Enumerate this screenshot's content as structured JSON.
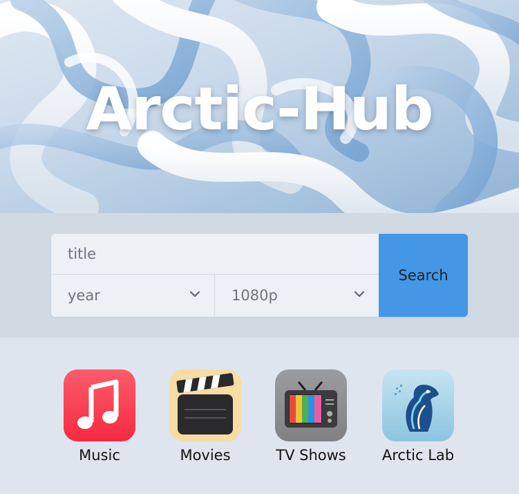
{
  "hero": {
    "title": "Arctic-Hub"
  },
  "search": {
    "title_placeholder": "title",
    "year_label": "year",
    "resolution_label": "1080p",
    "button_label": "Search"
  },
  "apps": [
    {
      "label": "Music",
      "icon": "music-note-icon",
      "color": "#f73a4e"
    },
    {
      "label": "Movies",
      "icon": "clapperboard-icon",
      "color": "#f7dca4"
    },
    {
      "label": "TV Shows",
      "icon": "retro-tv-icon",
      "color": "#8d8f92"
    },
    {
      "label": "Arctic Lab",
      "icon": "polar-bear-icon",
      "color": "#a9d5ea"
    }
  ],
  "colors": {
    "accent": "#4497e4",
    "band": "#d1d9e3",
    "page": "#dfe5ee"
  }
}
